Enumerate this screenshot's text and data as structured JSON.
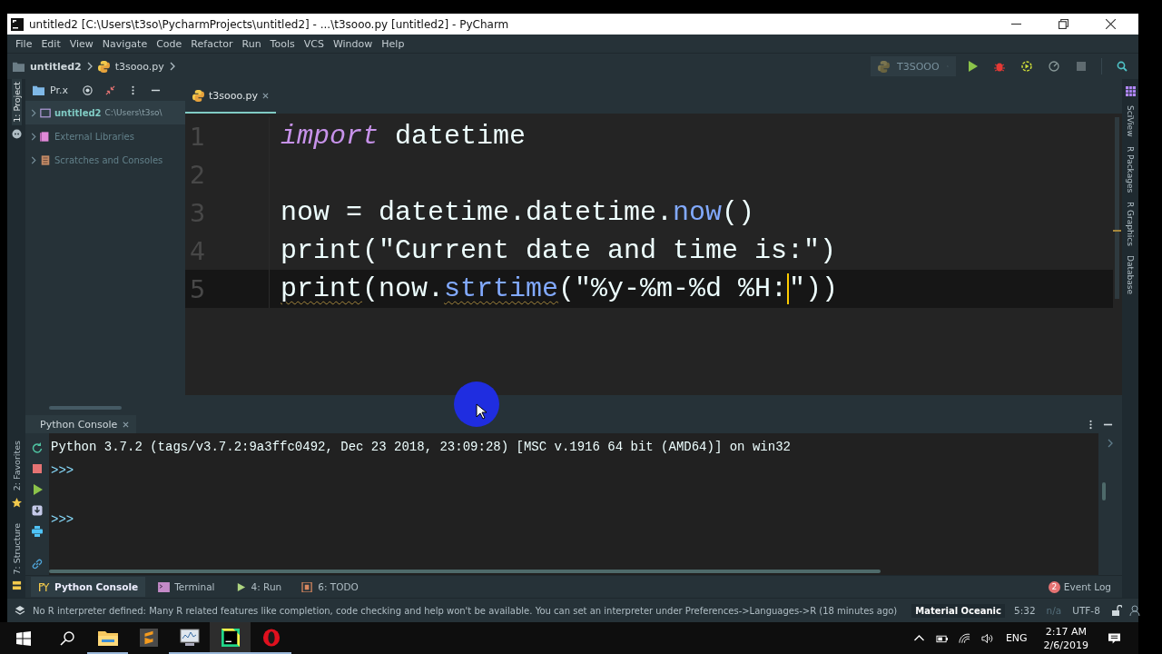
{
  "window": {
    "title": "untitled2 [C:\\Users\\t3so\\PycharmProjects\\untitled2] - ...\\t3sooo.py [untitled2] - PyCharm"
  },
  "menu": [
    "File",
    "Edit",
    "View",
    "Navigate",
    "Code",
    "Refactor",
    "Run",
    "Tools",
    "VCS",
    "Window",
    "Help"
  ],
  "breadcrumb": {
    "project": "untitled2",
    "file": "t3sooo.py"
  },
  "run_config": {
    "label": "T3SOOO"
  },
  "left_tools": [
    {
      "label": "1: Project",
      "selected": true
    },
    {
      "label": "2: Favorites",
      "selected": false
    },
    {
      "label": "7: Structure",
      "selected": false
    }
  ],
  "right_tools": [
    "SciView",
    "R Packages",
    "R Graphics",
    "Database"
  ],
  "project_panel": {
    "title": "Pr.x",
    "tree": [
      {
        "label": "untitled2",
        "path": "C:\\Users\\t3so\\",
        "kind": "folder",
        "selected": true
      },
      {
        "label": "External Libraries",
        "kind": "library",
        "selected": false
      },
      {
        "label": "Scratches and Consoles",
        "kind": "scratch",
        "selected": false
      }
    ]
  },
  "editor": {
    "tabs": [
      {
        "label": "t3sooo.py",
        "selected": true
      }
    ],
    "lines": [
      {
        "number": "1",
        "current": false,
        "tokens": [
          {
            "text": "import",
            "kind": "keyword"
          },
          {
            "text": " datetime",
            "kind": "text"
          }
        ]
      },
      {
        "number": "2",
        "current": false
      },
      {
        "number": "3",
        "current": false,
        "tokens": [
          {
            "text": "now = datetime.datetime.",
            "kind": "text"
          },
          {
            "text": "now",
            "kind": "call"
          },
          {
            "text": "()",
            "kind": "text"
          }
        ]
      },
      {
        "number": "4",
        "current": false,
        "tokens": [
          {
            "text": "print(\"Current date and time is:\")",
            "kind": "text"
          }
        ]
      },
      {
        "number": "5",
        "current": true,
        "tokens": [
          {
            "text": "print",
            "kind": "text",
            "warning": true
          },
          {
            "text": "(now.",
            "kind": "text"
          },
          {
            "text": "strtime",
            "kind": "call",
            "warning": true
          },
          {
            "text": "(\"%y-%m-%d %H:",
            "kind": "text",
            "caret": true
          },
          {
            "text": "\"))",
            "kind": "text"
          }
        ]
      }
    ]
  },
  "console": {
    "tab": "Python Console",
    "lines": [
      {
        "kind": "output",
        "text": "Python 3.7.2 (tags/v3.7.2:9a3ffc0492, Dec 23 2018, 23:09:28) [MSC v.1916 64 bit (AMD64)] on win32"
      },
      {
        "kind": "prompt",
        "text": ">>>"
      },
      {
        "kind": "prompt",
        "text": ">>>"
      }
    ]
  },
  "tool_tabs": [
    {
      "label": "Python Console",
      "kind": "python",
      "selected": true
    },
    {
      "label": "Terminal",
      "kind": "terminal",
      "selected": false
    },
    {
      "label": "4: Run",
      "kind": "run",
      "selected": false
    },
    {
      "label": "6: TODO",
      "kind": "todo",
      "selected": false
    }
  ],
  "event_log": {
    "count": "2",
    "label": "Event Log"
  },
  "status_bar": {
    "message": "No R interpreter defined: Many R related features like completion, code checking and help won't be available. You can set an interpreter under Preferences->Languages->R (18 minutes ago)",
    "theme": "Material Oceanic",
    "position": "5:32",
    "indent": "n/a",
    "encoding": "UTF-8"
  },
  "taskbar": {
    "apps": [
      {
        "kind": "explorer",
        "running": true,
        "active": false
      },
      {
        "kind": "sublime",
        "running": false,
        "active": false
      },
      {
        "kind": "monitor",
        "running": true,
        "active": false
      },
      {
        "kind": "pycharm",
        "running": true,
        "active": true
      },
      {
        "kind": "opera",
        "running": true,
        "active": false
      }
    ],
    "language": "ENG",
    "time": "2:17 AM",
    "date": "2/6/2019"
  }
}
